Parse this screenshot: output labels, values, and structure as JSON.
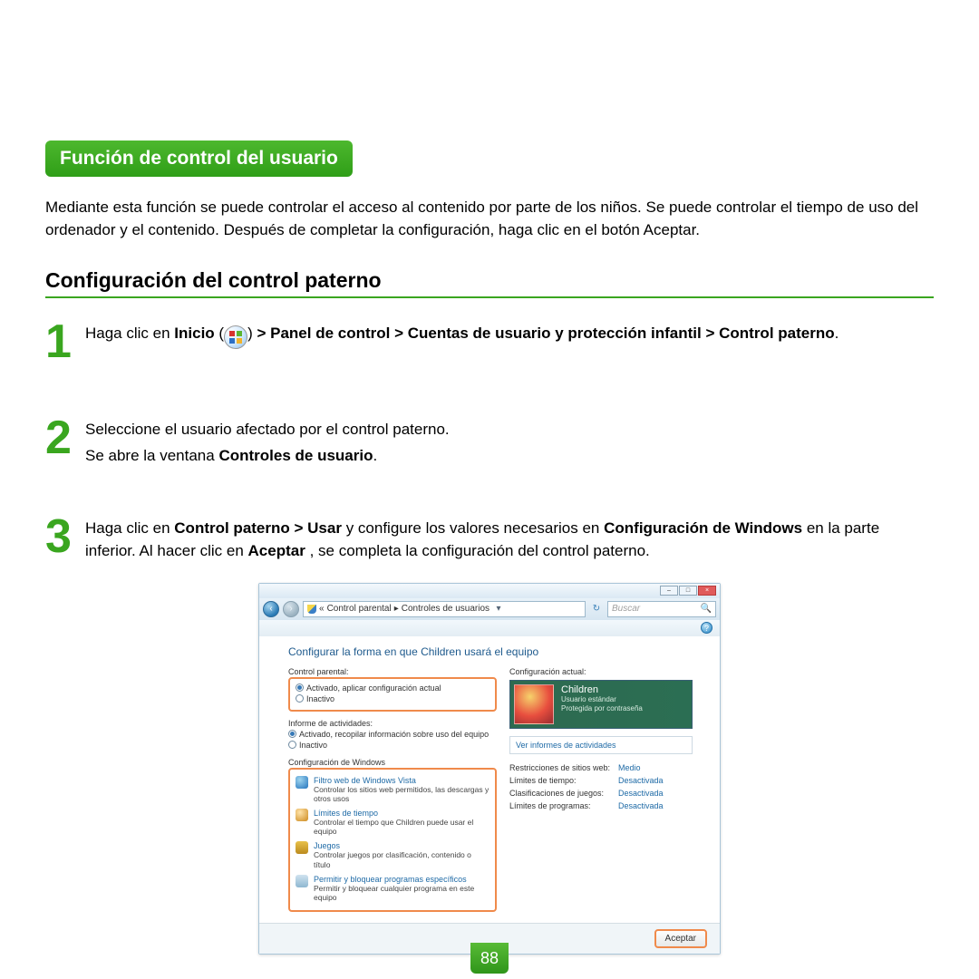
{
  "title": "Función de control del usuario",
  "intro": "Mediante esta función se puede controlar el acceso al contenido por parte de los niños. Se puede controlar el tiempo de uso del ordenador y el contenido. Después de completar la configuración, haga clic en el botón Aceptar.",
  "subheading": "Configuración del control paterno",
  "step1": {
    "pre": "Haga clic en ",
    "inicio": "Inicio",
    "post": " > Panel de control > Cuentas de usuario y protección infantil > Control paterno"
  },
  "step2": {
    "line1": "Seleccione el usuario afectado por el control paterno.",
    "line2_pre": "Se abre la ventana ",
    "line2_bold": "Controles de usuario"
  },
  "step3": {
    "t1": "Haga clic en ",
    "t2": "Control paterno > Usar",
    "t3": " y configure los valores necesarios en ",
    "t4": "Configuración de Windows",
    "t5": " en la parte inferior. Al hacer clic en ",
    "t6": "Aceptar",
    "t7": ", se completa la configuración del control paterno."
  },
  "window": {
    "breadcrumb1": "Control parental",
    "breadcrumb2": "Controles de usuarios",
    "search_placeholder": "Buscar",
    "heading": "Configurar la forma en que Children usará el equipo",
    "labels": {
      "control_parental": "Control parental:",
      "activado": "Activado, aplicar configuración actual",
      "inactivo": "Inactivo",
      "informe": "Informe de actividades:",
      "informe_on": "Activado, recopilar información sobre uso del equipo",
      "config_win": "Configuración de Windows",
      "conf_actual": "Configuración actual:",
      "ver_informes": "Ver informes de actividades"
    },
    "items": {
      "web_t": "Filtro web de Windows Vista",
      "web_d": "Controlar los sitios web permitidos, las descargas y otros usos",
      "time_t": "Límites de tiempo",
      "time_d": "Controlar el tiempo que Children puede usar el equipo",
      "games_t": "Juegos",
      "games_d": "Controlar juegos por clasificación, contenido o título",
      "apps_t": "Permitir y bloquear programas específicos",
      "apps_d": "Permitir y bloquear cualquier programa en este equipo"
    },
    "user": {
      "name": "Children",
      "type": "Usuario estándar",
      "prot": "Protegida por contraseña"
    },
    "summary": {
      "web_l": "Restricciones de sitios web:",
      "web_v": "Medio",
      "time_l": "Límites de tiempo:",
      "time_v": "Desactivada",
      "games_l": "Clasificaciones de juegos:",
      "games_v": "Desactivada",
      "apps_l": "Límites de programas:",
      "apps_v": "Desactivada"
    },
    "accept": "Aceptar"
  },
  "page_number": "88"
}
